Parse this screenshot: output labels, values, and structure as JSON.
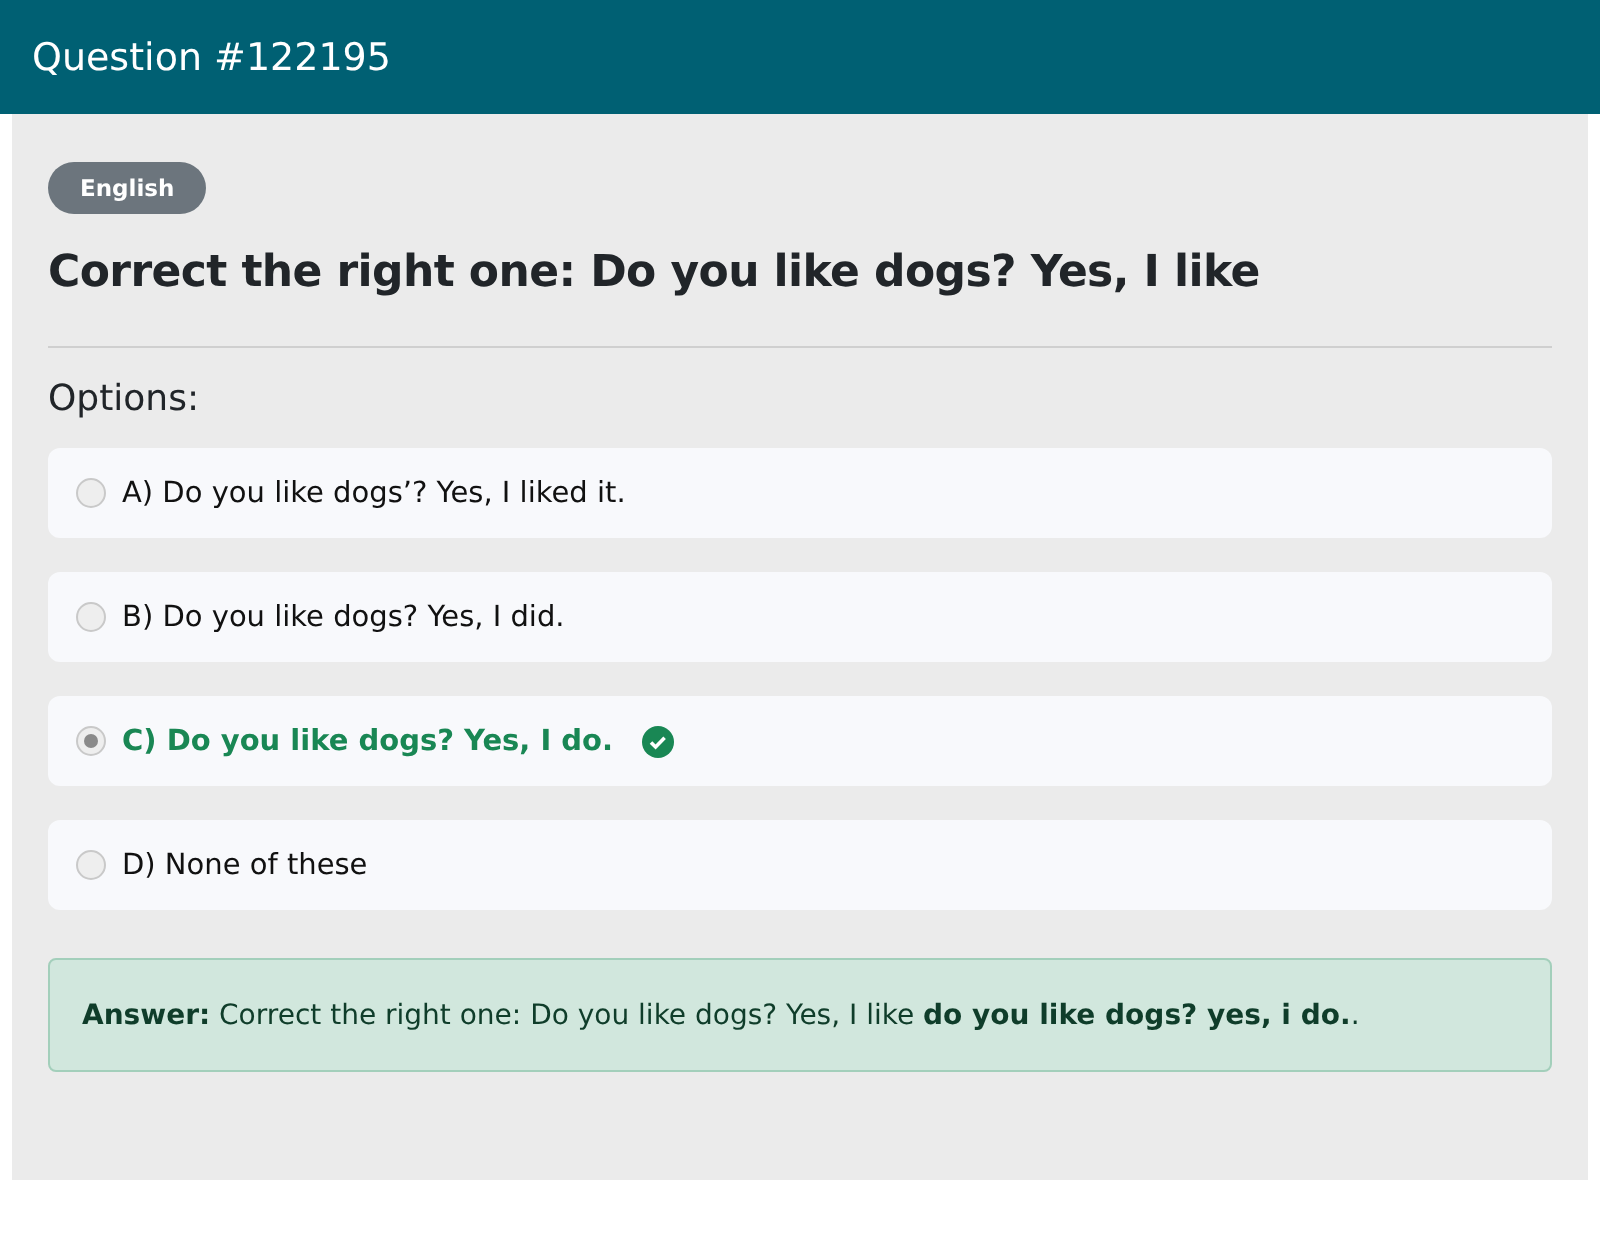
{
  "header": {
    "title": "Question #122195"
  },
  "badge": "English",
  "question": "Correct the right one: Do you like dogs? Yes, I like",
  "options_label": "Options:",
  "options": [
    {
      "text": "A) Do you like dogs’? Yes, I liked it.",
      "selected": false,
      "correct": false
    },
    {
      "text": "B) Do you like dogs? Yes, I did.",
      "selected": false,
      "correct": false
    },
    {
      "text": "C) Do you like dogs? Yes, I do.",
      "selected": true,
      "correct": true
    },
    {
      "text": "D) None of these",
      "selected": false,
      "correct": false
    }
  ],
  "answer": "**Answer:** Correct the right one: Do you like dogs? Yes, I like **do you like dogs? yes, i do.**."
}
